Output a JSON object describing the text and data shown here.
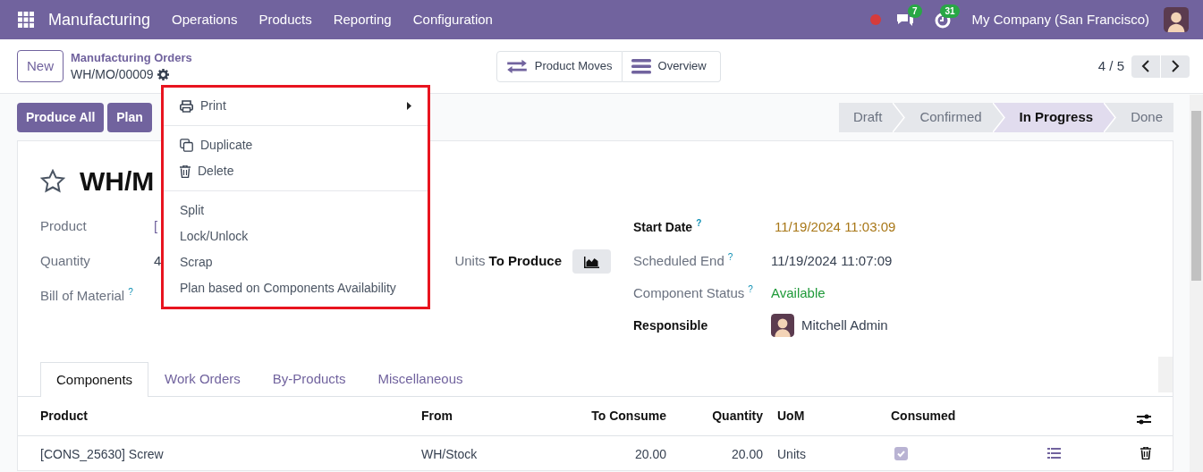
{
  "navbar": {
    "app_name": "Manufacturing",
    "menus": [
      "Operations",
      "Products",
      "Reporting",
      "Configuration"
    ],
    "messages_count": "7",
    "activities_count": "31",
    "company": "My Company (San Francisco)"
  },
  "control_panel": {
    "new_button": "New",
    "breadcrumb": "Manufacturing Orders",
    "record_name": "WH/MO/00009",
    "buttons": [
      {
        "label": "Product Moves",
        "kind": "moves"
      },
      {
        "label": "Overview",
        "kind": "overview"
      }
    ],
    "pager": "4 / 5"
  },
  "action_menu": {
    "sections": [
      [
        {
          "label": "Print",
          "kind": "print"
        }
      ],
      [
        {
          "label": "Duplicate",
          "kind": "duplicate"
        },
        {
          "label": "Delete",
          "kind": "delete"
        }
      ],
      [
        {
          "label": "Split",
          "kind": "plain"
        },
        {
          "label": "Lock/Unlock",
          "kind": "plain"
        },
        {
          "label": "Scrap",
          "kind": "plain"
        },
        {
          "label": "Plan based on Components Availability",
          "kind": "plain"
        }
      ]
    ]
  },
  "action_buttons": [
    "Produce All",
    "Plan"
  ],
  "statusbar": [
    {
      "label": "Draft",
      "selected": false
    },
    {
      "label": "Confirmed",
      "selected": false
    },
    {
      "label": "In Progress",
      "selected": true
    },
    {
      "label": "Done",
      "selected": false
    }
  ],
  "form": {
    "title": "WH/M",
    "starred": false,
    "left_fields": [
      {
        "label": "Product",
        "value": "["
      },
      {
        "label": "Quantity",
        "value": "4",
        "suffix": "Units",
        "suffix_bold": "To Produce"
      },
      {
        "label": "Bill of Material",
        "help": "?"
      }
    ],
    "right_fields": [
      {
        "label": "Start Date",
        "help": "?",
        "value": "11/19/2024 11:03:09",
        "required": true,
        "kind": "warning"
      },
      {
        "label": "Scheduled End",
        "help": "?",
        "value": "11/19/2024 11:07:09",
        "required": false,
        "kind": "plain"
      },
      {
        "label": "Component Status",
        "help": "?",
        "value": "Available",
        "required": false,
        "kind": "success"
      },
      {
        "label": "Responsible",
        "value": "Mitchell Admin",
        "required": true,
        "kind": "user"
      }
    ]
  },
  "tabs": [
    {
      "label": "Components",
      "selected": true
    },
    {
      "label": "Work Orders",
      "selected": false
    },
    {
      "label": "By-Products",
      "selected": false
    },
    {
      "label": "Miscellaneous",
      "selected": false
    }
  ],
  "table": {
    "columns": [
      "Product",
      "From",
      "To Consume",
      "Quantity",
      "UoM",
      "Consumed"
    ],
    "rows": [
      {
        "product": "[CONS_25630] Screw",
        "from": "WH/Stock",
        "to_consume": "20.00",
        "quantity": "20.00",
        "uom": "Units",
        "consumed": true
      }
    ]
  }
}
